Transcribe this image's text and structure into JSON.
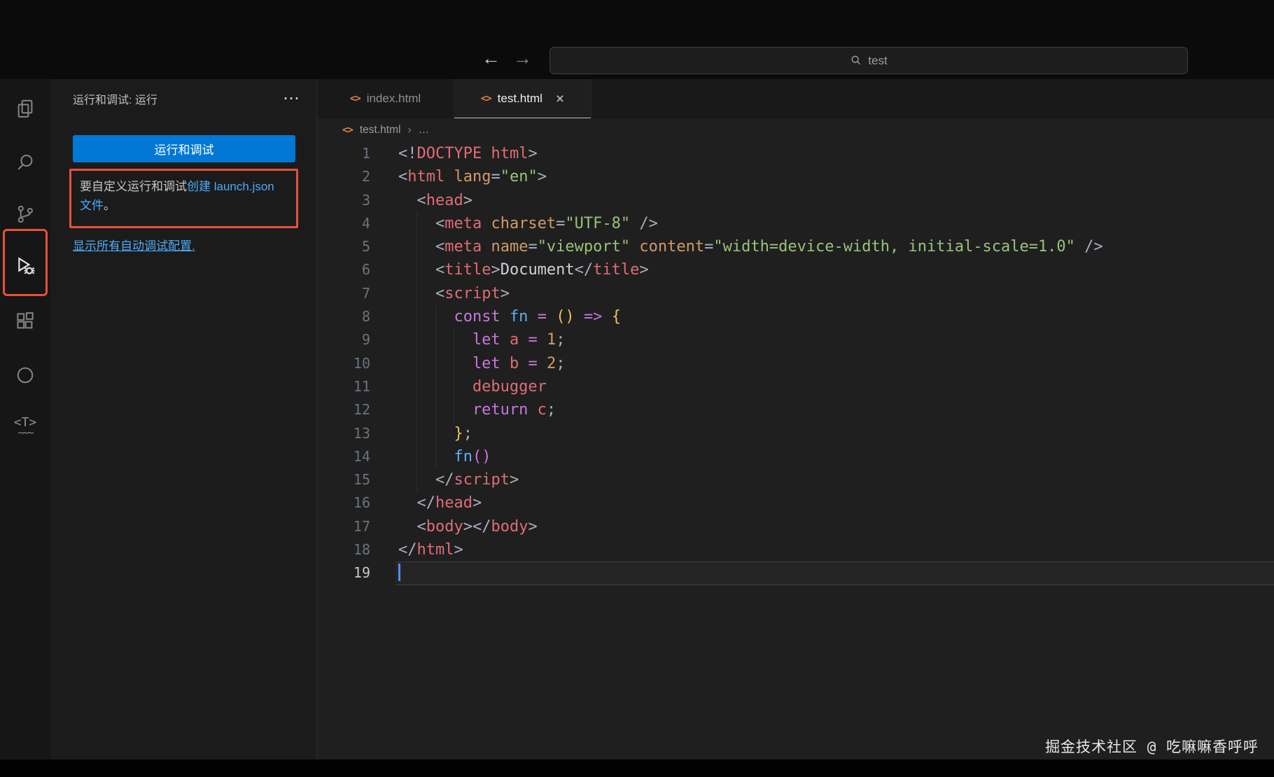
{
  "titlebar": {
    "back_label": "←",
    "forward_label": "→",
    "search_value": "test"
  },
  "activity_bar": {
    "items": [
      "explorer",
      "search",
      "source-control",
      "run-and-debug",
      "extensions",
      "circle-extension",
      "template-extension"
    ],
    "active_item": "run-and-debug",
    "template_icon_text": "<T>",
    "template_icon_wave": "~~~"
  },
  "sidebar": {
    "title": "运行和调试: 运行",
    "more_label": "⋯",
    "run_button_label": "运行和调试",
    "hint_text_before_link": "要自定义运行和调试",
    "hint_link": "创建 launch.json 文件",
    "hint_text_after_link": "。",
    "show_all_configs_link": "显示所有自动调试配置."
  },
  "editor": {
    "tabs": [
      {
        "label": "index.html",
        "icon": "<>",
        "active": false
      },
      {
        "label": "test.html",
        "icon": "<>",
        "active": true,
        "close_label": "×"
      }
    ],
    "breadcrumb": {
      "icon": "<>",
      "file": "test.html",
      "separator": "›",
      "more": "…"
    },
    "code": {
      "active_line": 19,
      "lines": [
        {
          "indent": 0,
          "tokens": [
            [
              "pun",
              "<!"
            ],
            [
              "tag",
              "DOCTYPE html"
            ],
            [
              "pun",
              ">"
            ]
          ]
        },
        {
          "indent": 0,
          "tokens": [
            [
              "pun",
              "<"
            ],
            [
              "tag",
              "html"
            ],
            [
              "txt",
              " "
            ],
            [
              "attr",
              "lang"
            ],
            [
              "pun",
              "="
            ],
            [
              "str",
              "\"en\""
            ],
            [
              "pun",
              ">"
            ]
          ]
        },
        {
          "indent": 1,
          "tokens": [
            [
              "pun",
              "<"
            ],
            [
              "tag",
              "head"
            ],
            [
              "pun",
              ">"
            ]
          ]
        },
        {
          "indent": 2,
          "tokens": [
            [
              "pun",
              "<"
            ],
            [
              "tag",
              "meta"
            ],
            [
              "txt",
              " "
            ],
            [
              "attr",
              "charset"
            ],
            [
              "pun",
              "="
            ],
            [
              "str",
              "\"UTF-8\""
            ],
            [
              "txt",
              " "
            ],
            [
              "pun",
              "/>"
            ]
          ]
        },
        {
          "indent": 2,
          "tokens": [
            [
              "pun",
              "<"
            ],
            [
              "tag",
              "meta"
            ],
            [
              "txt",
              " "
            ],
            [
              "attr",
              "name"
            ],
            [
              "pun",
              "="
            ],
            [
              "str",
              "\"viewport\""
            ],
            [
              "txt",
              " "
            ],
            [
              "attr",
              "content"
            ],
            [
              "pun",
              "="
            ],
            [
              "str",
              "\"width=device-width, initial-scale=1.0\""
            ],
            [
              "txt",
              " "
            ],
            [
              "pun",
              "/>"
            ]
          ]
        },
        {
          "indent": 2,
          "tokens": [
            [
              "pun",
              "<"
            ],
            [
              "tag",
              "title"
            ],
            [
              "pun",
              ">"
            ],
            [
              "txt",
              "Document"
            ],
            [
              "pun",
              "</"
            ],
            [
              "tag",
              "title"
            ],
            [
              "pun",
              ">"
            ]
          ]
        },
        {
          "indent": 2,
          "tokens": [
            [
              "pun",
              "<"
            ],
            [
              "tag",
              "script"
            ],
            [
              "pun",
              ">"
            ]
          ]
        },
        {
          "indent": 3,
          "tokens": [
            [
              "kw",
              "const"
            ],
            [
              "txt",
              " "
            ],
            [
              "fn",
              "fn"
            ],
            [
              "txt",
              " "
            ],
            [
              "op",
              "="
            ],
            [
              "txt",
              " "
            ],
            [
              "b1",
              "()"
            ],
            [
              "txt",
              " "
            ],
            [
              "op",
              "=>"
            ],
            [
              "txt",
              " "
            ],
            [
              "b1",
              "{"
            ]
          ]
        },
        {
          "indent": 4,
          "tokens": [
            [
              "kw",
              "let"
            ],
            [
              "txt",
              " "
            ],
            [
              "var",
              "a"
            ],
            [
              "txt",
              " "
            ],
            [
              "op",
              "="
            ],
            [
              "txt",
              " "
            ],
            [
              "num",
              "1"
            ],
            [
              "pun",
              ";"
            ]
          ]
        },
        {
          "indent": 4,
          "tokens": [
            [
              "kw",
              "let"
            ],
            [
              "txt",
              " "
            ],
            [
              "var",
              "b"
            ],
            [
              "txt",
              " "
            ],
            [
              "op",
              "="
            ],
            [
              "txt",
              " "
            ],
            [
              "num",
              "2"
            ],
            [
              "pun",
              ";"
            ]
          ]
        },
        {
          "indent": 4,
          "tokens": [
            [
              "var",
              "debugger"
            ]
          ]
        },
        {
          "indent": 4,
          "tokens": [
            [
              "kw",
              "return"
            ],
            [
              "txt",
              " "
            ],
            [
              "var",
              "c"
            ],
            [
              "pun",
              ";"
            ]
          ]
        },
        {
          "indent": 3,
          "tokens": [
            [
              "b1",
              "}"
            ],
            [
              "pun",
              ";"
            ]
          ]
        },
        {
          "indent": 3,
          "tokens": [
            [
              "fn",
              "fn"
            ],
            [
              "b2",
              "()"
            ]
          ]
        },
        {
          "indent": 2,
          "tokens": [
            [
              "pun",
              "</"
            ],
            [
              "tag",
              "script"
            ],
            [
              "pun",
              ">"
            ]
          ]
        },
        {
          "indent": 1,
          "tokens": [
            [
              "pun",
              "</"
            ],
            [
              "tag",
              "head"
            ],
            [
              "pun",
              ">"
            ]
          ]
        },
        {
          "indent": 1,
          "tokens": [
            [
              "pun",
              "<"
            ],
            [
              "tag",
              "body"
            ],
            [
              "pun",
              ">"
            ],
            [
              "pun",
              "</"
            ],
            [
              "tag",
              "body"
            ],
            [
              "pun",
              ">"
            ]
          ]
        },
        {
          "indent": 0,
          "tokens": [
            [
              "pun",
              "</"
            ],
            [
              "tag",
              "html"
            ],
            [
              "pun",
              ">"
            ]
          ]
        },
        {
          "indent": 0,
          "tokens": []
        }
      ]
    }
  },
  "watermark": "掘金技术社区 @ 吃嘛嘛香呼呼",
  "colors": {
    "accent_blue": "#0078d4",
    "annotation_red": "#e8503a",
    "link_blue": "#4daafc"
  }
}
